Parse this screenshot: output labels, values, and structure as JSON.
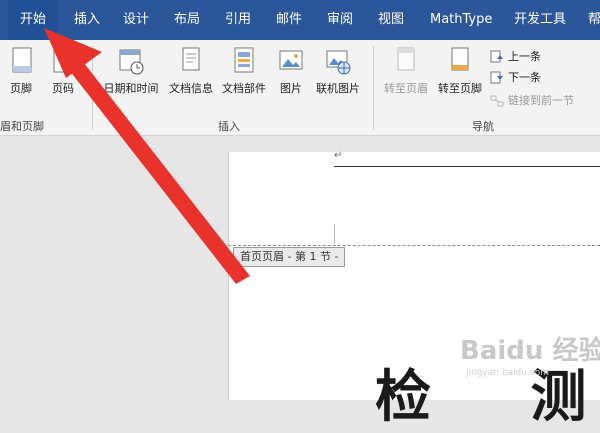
{
  "menubar": {
    "tabs": [
      "开始",
      "插入",
      "设计",
      "布局",
      "引用",
      "邮件",
      "审阅",
      "视图",
      "MathType",
      "开发工具",
      "帮"
    ]
  },
  "ribbon": {
    "buttons": {
      "footer": "页脚",
      "page_number": "页码",
      "date_time": "日期和时间",
      "doc_info": "文档信息",
      "doc_parts": "文档部件",
      "picture": "图片",
      "online_picture": "联机图片",
      "goto_header": "转至页眉",
      "goto_footer": "转至页脚"
    },
    "small_buttons": {
      "previous": "上一条",
      "next": "下一条",
      "link_previous": "链接到前一节"
    },
    "groups": {
      "header_footer": "眉和页脚",
      "insert": "插入",
      "navigation": "导航"
    }
  },
  "document": {
    "header_label": "首页页眉 - 第 1 节 -",
    "paragraph_mark": "↵",
    "body_text": "检 测"
  },
  "watermark": {
    "brand": "Baidu 经验",
    "url": "jingyan.baidu.com"
  },
  "colors": {
    "menubar": "#2b579a",
    "arrow": "#e8322b",
    "ribbon": "#f3f3f3"
  }
}
